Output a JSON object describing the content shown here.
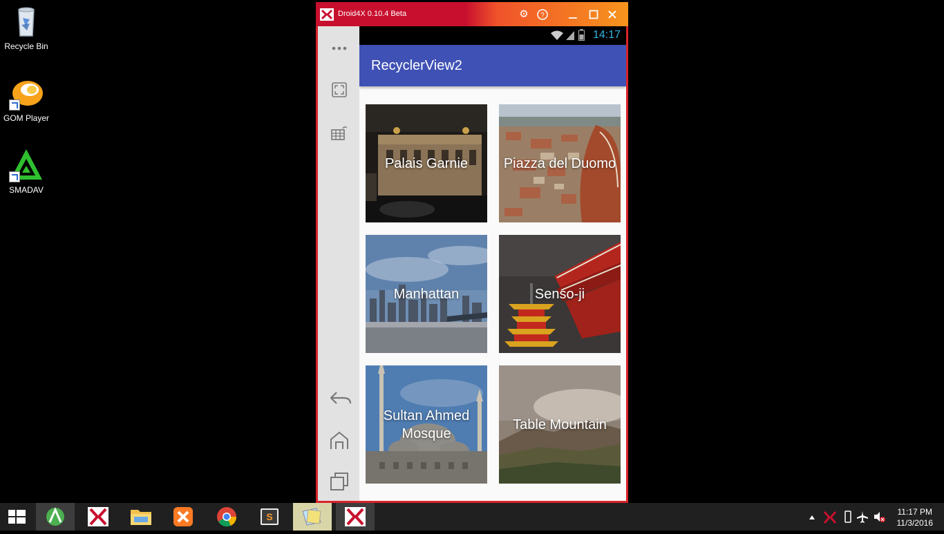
{
  "desktop": {
    "icons": [
      {
        "label": "Recycle Bin"
      },
      {
        "label": "GOM Player"
      },
      {
        "label": "SMADAV"
      }
    ]
  },
  "emulator": {
    "title": "Droid4X 0.10.4 Beta",
    "statusbar": {
      "time": "14:17"
    },
    "app": {
      "title": "RecyclerView2",
      "cards": [
        {
          "caption": "Palais Garnie"
        },
        {
          "caption": "Piazza del Duomo"
        },
        {
          "caption": "Manhattan"
        },
        {
          "caption": "Senso-ji"
        },
        {
          "caption": "Sultan Ahmed Mosque"
        },
        {
          "caption": "Table Mountain"
        }
      ]
    }
  },
  "taskbar": {
    "clock": {
      "time": "11:17 PM",
      "date": "11/3/2016"
    }
  },
  "colors": {
    "app_bar": "#3f51b5",
    "status_time": "#33b5e5",
    "emulator_frame": "#d9232b"
  }
}
